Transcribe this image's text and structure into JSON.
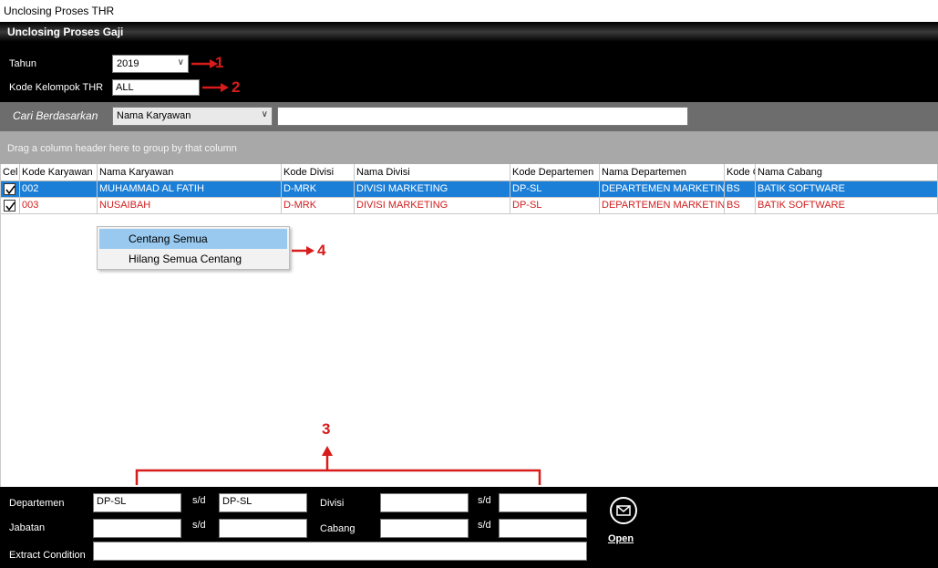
{
  "window": {
    "title": "Unclosing Proses THR"
  },
  "header": {
    "title": "Unclosing Proses Gaji"
  },
  "filters": {
    "tahun_label": "Tahun",
    "tahun_value": "2019",
    "kode_kelompok_label": "Kode Kelompok THR",
    "kode_kelompok_value": "ALL"
  },
  "search": {
    "label": "Cari Berdasarkan",
    "field_value": "Nama Karyawan",
    "query": ""
  },
  "grid": {
    "group_hint": "Drag a column header here to group by that column",
    "columns": [
      "Cel",
      "Kode Karyawan",
      "Nama Karyawan",
      "Kode Divisi",
      "Nama Divisi",
      "Kode Departemen",
      "Nama Departemen",
      "Kode C",
      "Nama Cabang"
    ],
    "rows": [
      {
        "checked": true,
        "kode": "002",
        "nama": "MUHAMMAD AL FATIH",
        "kode_divisi": "D-MRK",
        "nama_divisi": "DIVISI MARKETING",
        "kode_dept": "DP-SL",
        "nama_dept": "DEPARTEMEN MARKETING",
        "kode_cabang": "BS",
        "nama_cabang": "BATIK SOFTWARE"
      },
      {
        "checked": true,
        "kode": "003",
        "nama": "NUSAIBAH",
        "kode_divisi": "D-MRK",
        "nama_divisi": "DIVISI MARKETING",
        "kode_dept": "DP-SL",
        "nama_dept": "DEPARTEMEN MARKETING",
        "kode_cabang": "BS",
        "nama_cabang": "BATIK SOFTWARE"
      }
    ]
  },
  "context_menu": {
    "items": [
      "Centang Semua",
      "Hilang Semua Centang"
    ]
  },
  "annotations": [
    "1",
    "2",
    "3",
    "4"
  ],
  "bottom": {
    "departemen_label": "Departemen",
    "departemen_from": "DP-SL",
    "departemen_to": "DP-SL",
    "sd_label": "s/d",
    "divisi_label": "Divisi",
    "divisi_from": "",
    "divisi_to": "",
    "jabatan_label": "Jabatan",
    "jabatan_from": "",
    "jabatan_to": "",
    "cabang_label": "Cabang",
    "cabang_from": "",
    "cabang_to": "",
    "extract_label": "Extract Condition",
    "extract_value": "",
    "open_label": "Open"
  },
  "colors": {
    "annotation": "#d81b1b",
    "selection": "#1c7fd7",
    "row_text_red": "#d01d1d"
  }
}
